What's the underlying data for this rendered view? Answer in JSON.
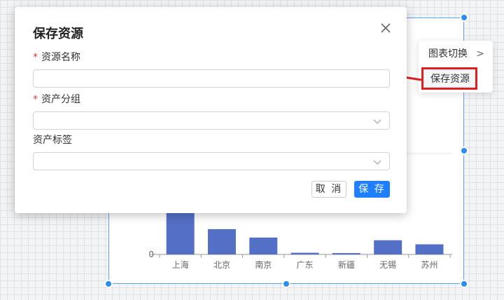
{
  "dialog": {
    "title": "保存资源",
    "fields": [
      {
        "label": "资源名称",
        "required": true,
        "type": "text",
        "value": ""
      },
      {
        "label": "资产分组",
        "required": true,
        "type": "select",
        "value": ""
      },
      {
        "label": "资产标签",
        "required": false,
        "type": "select",
        "value": ""
      }
    ],
    "cancel_label": "取 消",
    "save_label": "保 存"
  },
  "context_menu": {
    "items": [
      {
        "label": "图表切换",
        "has_submenu": true
      },
      {
        "label": "保存资源",
        "highlighted": true
      }
    ]
  },
  "colors": {
    "bar": "#5470c6",
    "primary": "#1e80ff",
    "highlight_border": "#e02020",
    "arrow": "#e02020",
    "selection": "#2d8cf0"
  },
  "chart_data": {
    "type": "bar",
    "categories": [
      "上海",
      "北京",
      "南京",
      "广东",
      "新疆",
      "无锡",
      "苏州"
    ],
    "values": [
      230,
      75,
      50,
      5,
      4,
      42,
      30
    ],
    "y_ticks": [
      "0"
    ],
    "ylim": [
      0,
      700
    ]
  }
}
